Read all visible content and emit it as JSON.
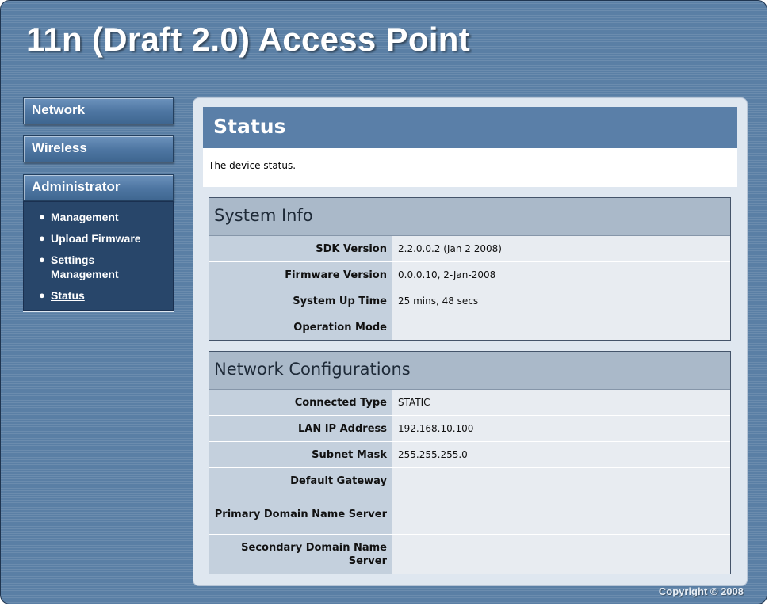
{
  "app": {
    "title": "11n (Draft 2.0) Access Point"
  },
  "sidebar": {
    "items": [
      {
        "label": "Network"
      },
      {
        "label": "Wireless"
      },
      {
        "label": "Administrator"
      }
    ],
    "admin_subitems": [
      {
        "label": "Management"
      },
      {
        "label": "Upload Firmware"
      },
      {
        "label": "Settings Management"
      },
      {
        "label": "Status",
        "current": true
      }
    ]
  },
  "page": {
    "title": "Status",
    "description": "The device status."
  },
  "system_info": {
    "title": "System Info",
    "rows": [
      {
        "label": "SDK Version",
        "value": "2.2.0.0.2 (Jan 2 2008)"
      },
      {
        "label": "Firmware Version",
        "value": "0.0.0.10, 2-Jan-2008"
      },
      {
        "label": "System Up Time",
        "value": "25 mins, 48 secs"
      },
      {
        "label": "Operation Mode",
        "value": ""
      }
    ]
  },
  "network_config": {
    "title": "Network Configurations",
    "rows": [
      {
        "label": "Connected Type",
        "value": "STATIC"
      },
      {
        "label": "LAN IP Address",
        "value": "192.168.10.100"
      },
      {
        "label": "Subnet Mask",
        "value": "255.255.255.0"
      },
      {
        "label": "Default Gateway",
        "value": ""
      },
      {
        "label": "Primary Domain Name Server",
        "value": ""
      },
      {
        "label": "Secondary Domain Name Server",
        "value": ""
      }
    ]
  },
  "footer": {
    "copyright": "Copyright © 2008"
  },
  "colors": {
    "frame": "#5a7fa5",
    "header_bar": "#5a7fa8",
    "sidebar_panel": "#28466a",
    "table_header": "#aab9c9",
    "label_cell": "#c4d0dd"
  }
}
